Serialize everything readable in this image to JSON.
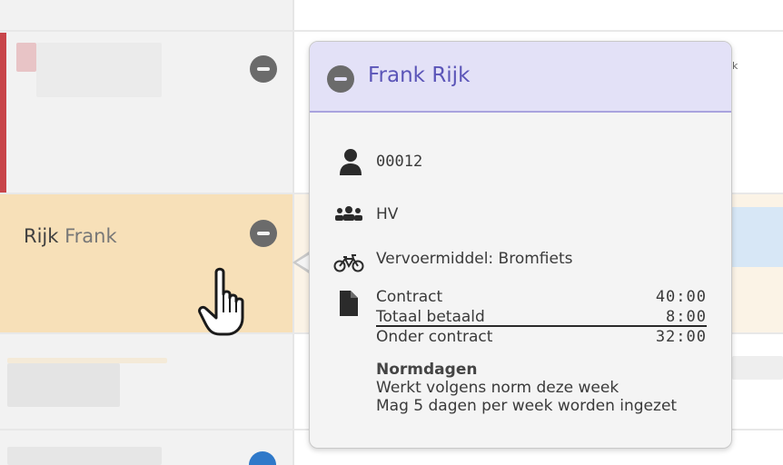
{
  "selected_employee": {
    "last_name": "Rijk",
    "first_name": "Frank"
  },
  "popover": {
    "title": "Frank Rijk",
    "employee_number": "00012",
    "department": "HV",
    "transport": "Vervoermiddel: Bromfiets",
    "contract": [
      {
        "label": "Contract",
        "value": "40:00"
      },
      {
        "label": "Totaal betaald",
        "value": "8:00"
      },
      {
        "label": "Onder contract",
        "value": "32:00"
      }
    ],
    "norm": {
      "title": "Normdagen",
      "line1": "Werkt volgens norm deze week",
      "line2": "Mag 5 dagen per week worden ingezet"
    }
  },
  "partial_text_right": "k",
  "icons": {
    "remove": "minus-circle-icon",
    "employee": "person-icon",
    "department": "group-icon",
    "transport": "bicycle-icon",
    "contract": "document-icon",
    "cursor": "hand-pointer-icon"
  },
  "colors": {
    "popover_header_bg": "#e3e1f7",
    "popover_title": "#5b55b8",
    "selected_row": "#f7e0b8",
    "alert_bar": "#c8454a",
    "blue_dot": "#2f79c9"
  }
}
